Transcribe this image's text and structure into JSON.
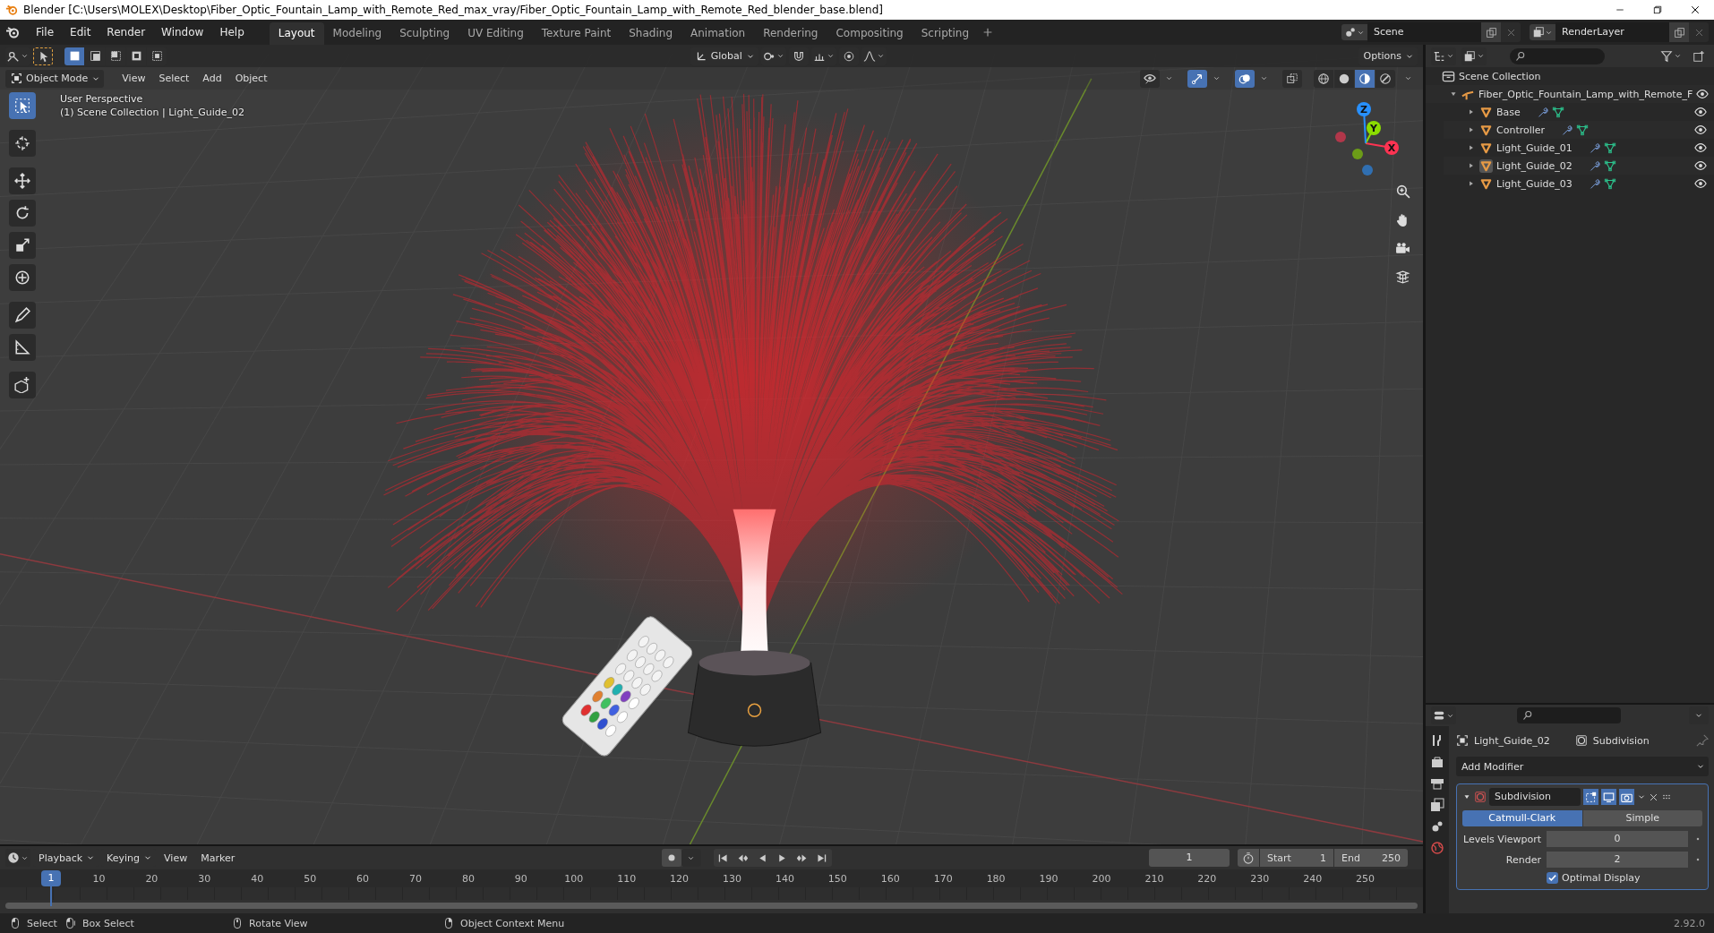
{
  "window": {
    "title": "Blender [C:\\Users\\MOLEX\\Desktop\\Fiber_Optic_Fountain_Lamp_with_Remote_Red_max_vray/Fiber_Optic_Fountain_Lamp_with_Remote_Red_blender_base.blend]"
  },
  "menu": [
    "File",
    "Edit",
    "Render",
    "Window",
    "Help"
  ],
  "workspaces": [
    {
      "label": "Layout",
      "selected": true
    },
    {
      "label": "Modeling",
      "selected": false
    },
    {
      "label": "Sculpting",
      "selected": false
    },
    {
      "label": "UV Editing",
      "selected": false
    },
    {
      "label": "Texture Paint",
      "selected": false
    },
    {
      "label": "Shading",
      "selected": false
    },
    {
      "label": "Animation",
      "selected": false
    },
    {
      "label": "Rendering",
      "selected": false
    },
    {
      "label": "Compositing",
      "selected": false
    },
    {
      "label": "Scripting",
      "selected": false
    }
  ],
  "scene": {
    "value": "Scene"
  },
  "view_layer": {
    "value": "RenderLayer"
  },
  "tool_settings": {
    "select_modes": [
      {
        "selected": true
      },
      {
        "selected": false
      },
      {
        "selected": false
      },
      {
        "selected": false
      },
      {
        "selected": false
      }
    ],
    "orientation": "Global",
    "options": "Options"
  },
  "viewport_header": {
    "mode": "Object Mode",
    "menus": [
      "View",
      "Select",
      "Add",
      "Object"
    ],
    "toggles": [
      {
        "kind": "visibility",
        "on": false
      },
      {
        "kind": "gizmo",
        "on": true
      },
      {
        "kind": "overlay",
        "on": true
      },
      {
        "kind": "xray",
        "on": false
      }
    ],
    "shading": [
      {
        "kind": "wireframe",
        "selected": false
      },
      {
        "kind": "solid",
        "selected": false
      },
      {
        "kind": "material",
        "selected": true
      },
      {
        "kind": "rendered",
        "selected": false
      }
    ]
  },
  "viewport": {
    "info": [
      "User Perspective",
      "(1) Scene Collection | Light_Guide_02"
    ],
    "tools": [
      {
        "kind": "select",
        "selected": true
      },
      {
        "kind": "cursor",
        "selected": false
      },
      {
        "kind": "move",
        "selected": false
      },
      {
        "kind": "rotate",
        "selected": false
      },
      {
        "kind": "scale",
        "selected": false
      },
      {
        "kind": "transform",
        "selected": false
      },
      {
        "kind": "annotate",
        "selected": false
      },
      {
        "kind": "measure",
        "selected": false
      },
      {
        "kind": "add-cube",
        "selected": false
      }
    ],
    "gizmo_axes": [
      {
        "label": "X",
        "color": "#ff3352"
      },
      {
        "label": "Y",
        "color": "#8bdc00"
      },
      {
        "label": "Z",
        "color": "#2890ff"
      }
    ]
  },
  "outliner": {
    "root": "Scene Collection",
    "children": [
      {
        "name": "Fiber_Optic_Fountain_Lamp_with_Remote_F",
        "kind": "empty",
        "expanded": true,
        "children": [
          {
            "name": "Base",
            "kind": "mesh",
            "expanded": false,
            "active": false
          },
          {
            "name": "Controller",
            "kind": "mesh",
            "expanded": false,
            "active": false
          },
          {
            "name": "Light_Guide_01",
            "kind": "mesh",
            "expanded": false,
            "active": false
          },
          {
            "name": "Light_Guide_02",
            "kind": "mesh",
            "expanded": false,
            "active": true
          },
          {
            "name": "Light_Guide_03",
            "kind": "mesh",
            "expanded": false,
            "active": false
          }
        ]
      }
    ]
  },
  "properties": {
    "object": "Light_Guide_02",
    "modifier": "Subdivision",
    "add_modifier": "Add Modifier",
    "modifier_panel": {
      "expanded": true,
      "name": "Subdivision",
      "toggles": [
        {
          "kind": "edit",
          "on": true
        },
        {
          "kind": "viewport",
          "on": true
        },
        {
          "kind": "render",
          "on": true
        }
      ],
      "types": [
        {
          "label": "Catmull-Clark",
          "selected": true
        },
        {
          "label": "Simple",
          "selected": false
        }
      ],
      "fields": [
        {
          "label": "Levels Viewport",
          "value": "0"
        },
        {
          "label": "Render",
          "value": "2"
        }
      ],
      "optimal_display": {
        "label": "Optimal Display",
        "checked": true
      }
    }
  },
  "timeline": {
    "menus": [
      "Playback",
      "Keying",
      "View",
      "Marker"
    ],
    "current_frame": "1",
    "start": {
      "label": "Start",
      "value": "1"
    },
    "end": {
      "label": "End",
      "value": "250"
    },
    "playhead": "1",
    "ruler": [
      "10",
      "20",
      "30",
      "40",
      "50",
      "60",
      "70",
      "80",
      "90",
      "100",
      "110",
      "120",
      "130",
      "140",
      "150",
      "160",
      "170",
      "180",
      "190",
      "200",
      "210",
      "220",
      "230",
      "240",
      "250"
    ]
  },
  "status_bar": {
    "hints": [
      {
        "kind": "left",
        "label": "Select"
      },
      {
        "kind": "drag",
        "label": "Box Select"
      },
      {
        "kind": "middle",
        "label": "Rotate View"
      },
      {
        "kind": "right",
        "label": "Object Context Menu"
      }
    ],
    "version": "2.92.0"
  }
}
